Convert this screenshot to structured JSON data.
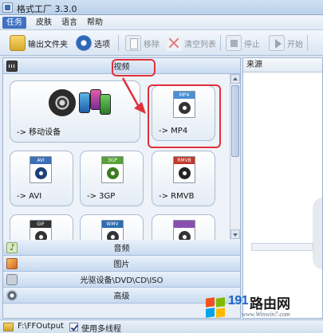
{
  "window": {
    "title": "格式工厂 3.3.0"
  },
  "menu": {
    "items": [
      "任务",
      "皮肤",
      "语言",
      "帮助"
    ],
    "active_index": 0
  },
  "toolbar": {
    "output_folder_label": "输出文件夹",
    "options_label": "选项",
    "remove_label": "移除",
    "clear_list_label": "清空列表",
    "stop_label": "停止",
    "start_label": "开始"
  },
  "categories": {
    "video": {
      "label": "视频",
      "expanded": true,
      "icon": "film-icon"
    },
    "audio": {
      "label": "音频",
      "icon": "music-note-icon"
    },
    "image": {
      "label": "图片",
      "icon": "picture-icon"
    },
    "disc": {
      "label": "光驱设备\\DVD\\CD\\ISO",
      "icon": "disc-drive-icon"
    },
    "advanced": {
      "label": "高级",
      "icon": "gear-icon"
    }
  },
  "video_tiles": [
    {
      "label": "-> 移动设备",
      "icon": "mobile-device-icon"
    },
    {
      "label": "-> MP4",
      "badge": "MP4",
      "icon": "mp4-file-icon",
      "highlighted": true
    },
    {
      "label": "-> AVI",
      "badge": "AVI",
      "icon": "avi-file-icon"
    },
    {
      "label": "-> 3GP",
      "badge": "3GP",
      "icon": "3gp-file-icon"
    },
    {
      "label": "-> RMVB",
      "badge": "RMVB",
      "icon": "rmvb-file-icon"
    },
    {
      "label": "",
      "badge": "GIF",
      "icon": "gif-file-icon"
    },
    {
      "label": "",
      "badge": "WMV",
      "icon": "wmv-file-icon"
    },
    {
      "label": "",
      "badge": "",
      "icon": "file-icon"
    }
  ],
  "right_panel": {
    "header": "来源"
  },
  "status_bar": {
    "output_path": "F:\\FFOutput",
    "multithread_label": "使用多线程",
    "multithread_checked": true
  },
  "watermark": {
    "number": "191",
    "cn": "路由网",
    "url": "www.Winwin7.com"
  },
  "colors": {
    "annotation": "#e0303a",
    "accent": "#3f72c0"
  }
}
